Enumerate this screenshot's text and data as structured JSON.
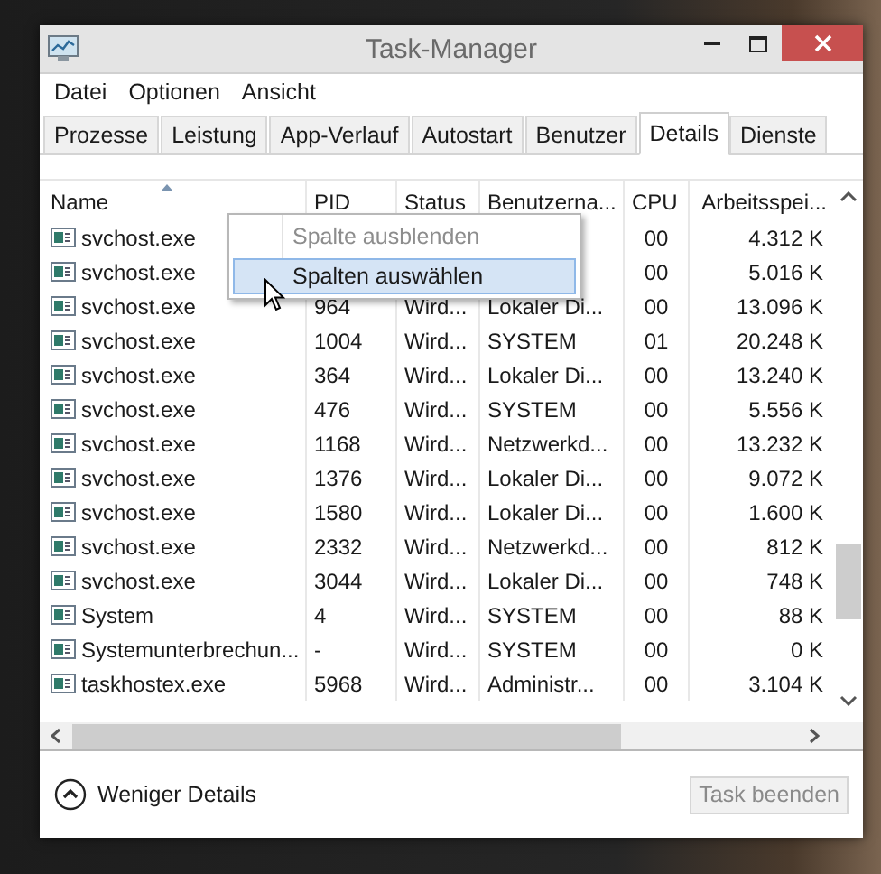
{
  "window": {
    "title": "Task-Manager"
  },
  "menu": [
    "Datei",
    "Optionen",
    "Ansicht"
  ],
  "tabs": [
    {
      "label": "Prozesse",
      "selected": false
    },
    {
      "label": "Leistung",
      "selected": false
    },
    {
      "label": "App-Verlauf",
      "selected": false
    },
    {
      "label": "Autostart",
      "selected": false
    },
    {
      "label": "Benutzer",
      "selected": false
    },
    {
      "label": "Details",
      "selected": true
    },
    {
      "label": "Dienste",
      "selected": false
    }
  ],
  "table": {
    "columns": [
      {
        "label": "Name",
        "sorted": true
      },
      {
        "label": "PID",
        "sorted": false
      },
      {
        "label": "Status",
        "sorted": false
      },
      {
        "label": "Benutzerna...",
        "sorted": false
      },
      {
        "label": "CPU",
        "sorted": false
      },
      {
        "label": "Arbeitsspei...",
        "sorted": false
      }
    ],
    "rows": [
      {
        "name": "svchost.exe",
        "cpu": "00",
        "memory": "4.312 K"
      },
      {
        "name": "svchost.exe",
        "cpu": "00",
        "memory": "5.016 K"
      },
      {
        "name": "svchost.exe",
        "pid": "964",
        "status": "Wird...",
        "user": "Lokaler Di...",
        "cpu": "00",
        "memory": "13.096 K"
      },
      {
        "name": "svchost.exe",
        "pid": "1004",
        "status": "Wird...",
        "user": "SYSTEM",
        "cpu": "01",
        "memory": "20.248 K"
      },
      {
        "name": "svchost.exe",
        "pid": "364",
        "status": "Wird...",
        "user": "Lokaler Di...",
        "cpu": "00",
        "memory": "13.240 K"
      },
      {
        "name": "svchost.exe",
        "pid": "476",
        "status": "Wird...",
        "user": "SYSTEM",
        "cpu": "00",
        "memory": "5.556 K"
      },
      {
        "name": "svchost.exe",
        "pid": "1168",
        "status": "Wird...",
        "user": "Netzwerkd...",
        "cpu": "00",
        "memory": "13.232 K"
      },
      {
        "name": "svchost.exe",
        "pid": "1376",
        "status": "Wird...",
        "user": "Lokaler Di...",
        "cpu": "00",
        "memory": "9.072 K"
      },
      {
        "name": "svchost.exe",
        "pid": "1580",
        "status": "Wird...",
        "user": "Lokaler Di...",
        "cpu": "00",
        "memory": "1.600 K"
      },
      {
        "name": "svchost.exe",
        "pid": "2332",
        "status": "Wird...",
        "user": "Netzwerkd...",
        "cpu": "00",
        "memory": "812 K"
      },
      {
        "name": "svchost.exe",
        "pid": "3044",
        "status": "Wird...",
        "user": "Lokaler Di...",
        "cpu": "00",
        "memory": "748 K"
      },
      {
        "name": "System",
        "pid": "4",
        "status": "Wird...",
        "user": "SYSTEM",
        "cpu": "00",
        "memory": "88 K"
      },
      {
        "name": "Systemunterbrechun...",
        "pid": "-",
        "status": "Wird...",
        "user": "SYSTEM",
        "cpu": "00",
        "memory": "0 K"
      },
      {
        "name": "taskhostex.exe",
        "pid": "5968",
        "status": "Wird...",
        "user": "Administr...",
        "cpu": "00",
        "memory": "3.104 K"
      }
    ]
  },
  "context_menu": {
    "items": [
      {
        "label": "Spalte ausblenden",
        "disabled": true,
        "selected": false
      },
      {
        "label": "Spalten auswählen",
        "disabled": false,
        "selected": true
      }
    ]
  },
  "footer": {
    "toggle": "Weniger Details",
    "button": {
      "label": "Task beenden",
      "disabled": true
    }
  }
}
